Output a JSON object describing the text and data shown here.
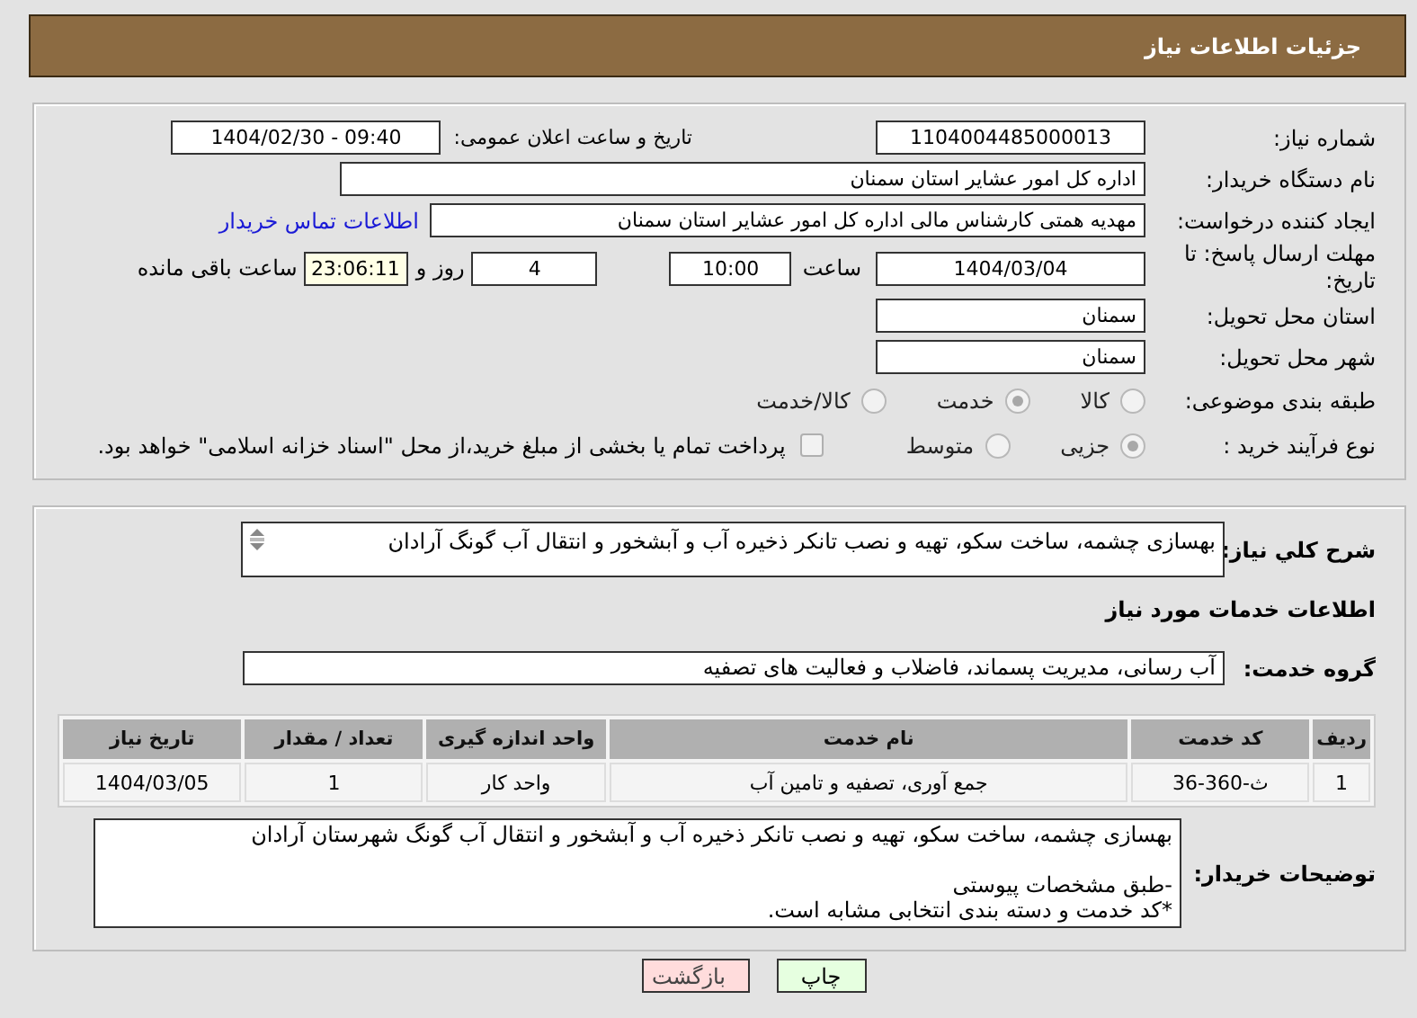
{
  "header": {
    "title": "جزئیات اطلاعات نیاز"
  },
  "details": {
    "need_number": {
      "label": "شماره نیاز:",
      "value": "1104004485000013"
    },
    "announce": {
      "label": "تاریخ و ساعت اعلان عمومی:",
      "value": "1404/02/30 - 09:40"
    },
    "buyer_org": {
      "label": "نام دستگاه خریدار:",
      "value": "اداره کل امور عشایر استان سمنان"
    },
    "requester": {
      "label": "ایجاد کننده درخواست:",
      "value": "مهدیه همتی کارشناس مالی اداره کل امور عشایر استان سمنان",
      "link": "اطلاعات تماس خریدار"
    },
    "deadline": {
      "label": "مهلت ارسال پاسخ: تا تاریخ:",
      "date": "1404/03/04",
      "time_label": "ساعت",
      "time": "10:00",
      "days": "4",
      "days_label": "روز و",
      "remaining": "23:06:11",
      "remaining_label": "ساعت باقی مانده"
    },
    "province": {
      "label": "استان محل تحویل:",
      "value": "سمنان"
    },
    "city": {
      "label": "شهر محل تحویل:",
      "value": "سمنان"
    },
    "category": {
      "label": "طبقه بندی موضوعی:",
      "disabled": true,
      "options": [
        {
          "label": "کالا",
          "selected": false
        },
        {
          "label": "خدمت",
          "selected": true
        },
        {
          "label": "کالا/خدمت",
          "selected": false
        }
      ]
    },
    "purchase_type": {
      "label": "نوع فرآیند خرید :",
      "disabled": true,
      "options": [
        {
          "label": "جزیی",
          "selected": true
        },
        {
          "label": "متوسط",
          "selected": false
        }
      ],
      "prepay": {
        "label": "پرداخت تمام یا بخشی از مبلغ خرید،از محل \"اسناد خزانه اسلامی\" خواهد بود.",
        "checked": false
      }
    }
  },
  "needs": {
    "summary": {
      "label": "شرح كلي نياز:",
      "value": "بهسازی چشمه، ساخت سکو، تهیه و نصب تانکر ذخیره آب و آبشخور و انتقال آب گونگ آرادان"
    },
    "section_title": "اطلاعات خدمات مورد نیاز",
    "service_group": {
      "label": "گروه خدمت:",
      "value": "آب رسانی، مدیریت پسماند، فاضلاب و فعالیت های تصفیه"
    },
    "table": {
      "columns": [
        "ردیف",
        "کد خدمت",
        "نام خدمت",
        "واحد اندازه گیری",
        "تعداد / مقدار",
        "تاریخ نیاز"
      ],
      "rows": [
        [
          "1",
          "ث-360-36",
          "جمع آوری، تصفیه و تامین آب",
          "واحد کار",
          "1",
          "1404/03/05"
        ]
      ]
    },
    "notes": {
      "label": "توضیحات خریدار:",
      "value": "بهسازی چشمه، ساخت سکو، تهیه و نصب تانکر ذخیره آب و آبشخور و انتقال آب گونگ شهرستان آرادان\n\n-طبق مشخصات پیوستی\n*کد خدمت و دسته بندی انتخابی مشابه است."
    }
  },
  "actions": [
    {
      "label": "چاپ",
      "kind": "print"
    },
    {
      "label": "بازگشت",
      "kind": "back"
    }
  ]
}
